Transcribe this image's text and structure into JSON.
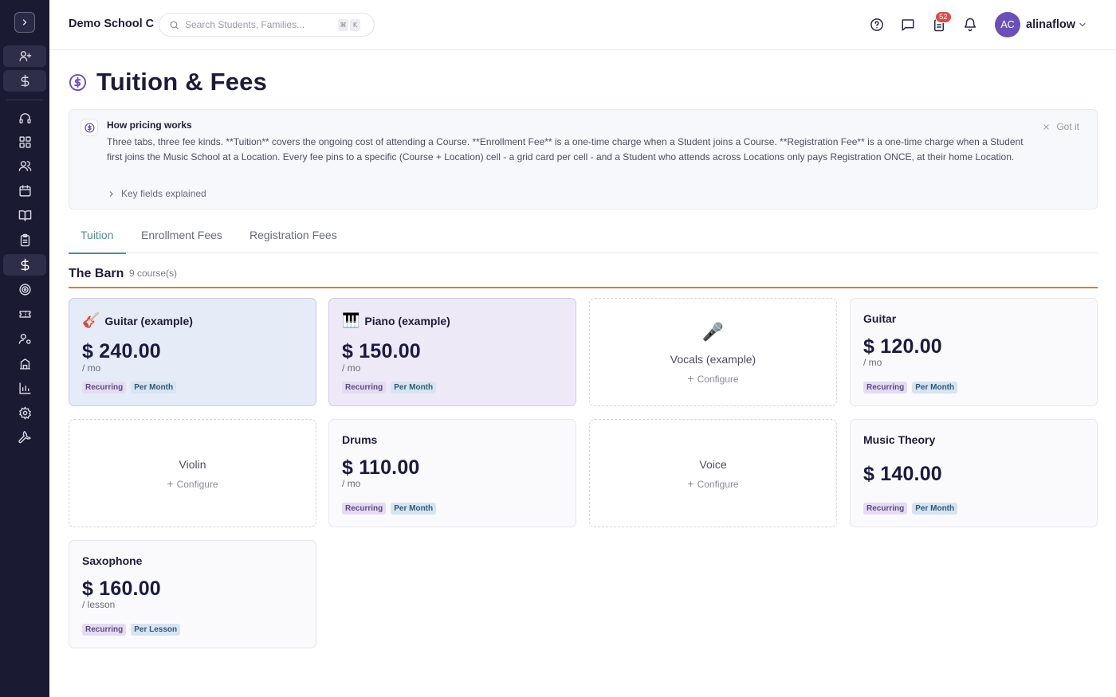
{
  "header": {
    "school_name": "Demo School C",
    "search_placeholder": "Search Students, Families...",
    "kbd_1": "⌘",
    "kbd_2": "K",
    "tasks_badge": "52",
    "avatar_initials": "AC",
    "username": "alinaflow"
  },
  "page": {
    "title": "Tuition & Fees"
  },
  "info": {
    "heading": "How pricing works",
    "body": "Three tabs, three fee kinds. **Tuition** covers the ongoing cost of attending a Course. **Enrollment Fee** is a one-time charge when a Student joins a Course. **Registration Fee** is a one-time charge when a Student first joins the Music School at a Location. Every fee pins to a specific (Course + Location) cell - a grid card per cell - and a Student who attends across Locations only pays Registration ONCE, at their home Location.",
    "dismiss": "Got it",
    "expand": "Key fields explained"
  },
  "tabs": [
    {
      "label": "Tuition",
      "active": true
    },
    {
      "label": "Enrollment Fees",
      "active": false
    },
    {
      "label": "Registration Fees",
      "active": false
    }
  ],
  "location": {
    "name": "The Barn",
    "count": "9 course(s)"
  },
  "cards": [
    {
      "title": "Guitar (example)",
      "emoji": "🎸",
      "price": "$ 240.00",
      "unit": "/ mo",
      "tags": [
        "Recurring",
        "Per Month"
      ]
    },
    {
      "title": "Piano (example)",
      "emoji": "🎹",
      "price": "$ 150.00",
      "unit": "/ mo",
      "tags": [
        "Recurring",
        "Per Month"
      ]
    },
    {
      "title": "Vocals (example)",
      "emoji": "🎤",
      "configure": "Configure"
    },
    {
      "title": "Guitar",
      "price": "$ 120.00",
      "unit": "/ mo",
      "tags": [
        "Recurring",
        "Per Month"
      ]
    },
    {
      "title": "Violin",
      "configure": "Configure"
    },
    {
      "title": "Drums",
      "price": "$ 110.00",
      "unit": "/ mo",
      "tags": [
        "Recurring",
        "Per Month"
      ]
    },
    {
      "title": "Voice",
      "configure": "Configure"
    },
    {
      "title": "Music Theory",
      "price": "$ 140.00",
      "tags": [
        "Recurring",
        "Per Month"
      ]
    },
    {
      "title": "Saxophone",
      "price": "$ 160.00",
      "unit": "/ lesson",
      "tags": [
        "Recurring",
        "Per Lesson"
      ]
    }
  ],
  "colors": {
    "sidebar_bg": "#1b1a33",
    "accent_teal": "#4a8f9a",
    "location_rule": "#e07a32",
    "badge_red": "#e0484b",
    "avatar_purple": "#6b4fb8"
  }
}
